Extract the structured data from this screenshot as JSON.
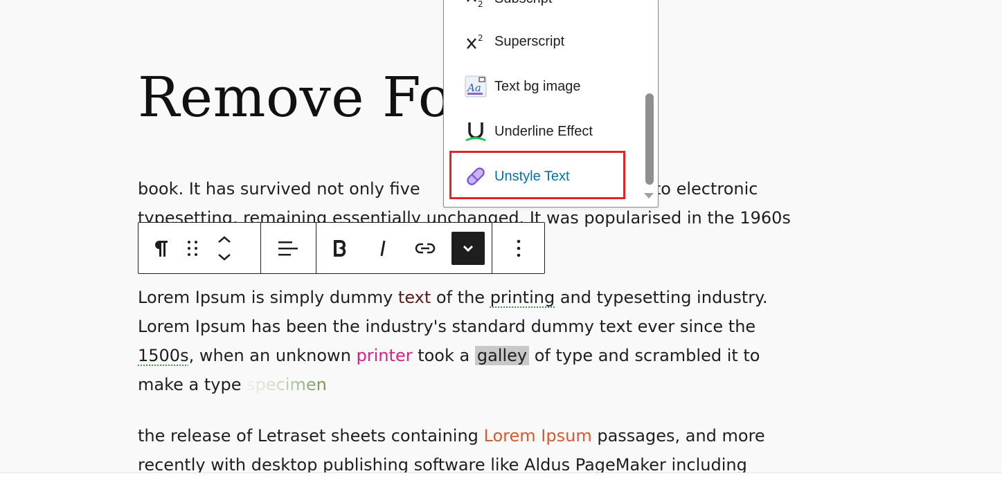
{
  "post_title": "Remove Forr",
  "paragraph_1": {
    "line1_a": "book. It has survived not only five",
    "line1_b": "eap into electronic",
    "line2": "typesetting, remaining essentially unchanged. It was popularised in the 1960s"
  },
  "paragraph_2": {
    "line1": {
      "a": "Lorem Ipsum is simply dummy ",
      "red": "text",
      "b": " of the ",
      "dotted": "printing",
      "c": " and typesetting industry."
    },
    "line2": "Lorem Ipsum has been the industry's standard dummy text ever since the",
    "line3": {
      "dotted": "1500s",
      "a": ", when an unknown ",
      "pink": "printer",
      "b": " took a ",
      "highlight": "galley",
      "c": " of type and scrambled it to"
    },
    "line4": {
      "a": "make a type ",
      "gradient": "specimen"
    }
  },
  "paragraph_3": {
    "line1": {
      "a": "the release of Letraset sheets containing ",
      "orange": "Lorem Ipsum",
      "b": " passages, and more"
    },
    "line2": "recently with desktop publishing software like Aldus PageMaker including"
  },
  "toolbar": {
    "paragraph": "paragraph-icon",
    "drag": "drag-handle-icon",
    "move": "move-up-down-icon",
    "align": "align-left-icon",
    "bold": "bold-icon",
    "italic": "italic-icon",
    "link": "link-icon",
    "more_rich_text": "chevron-down-icon",
    "options": "more-vertical-icon"
  },
  "format_menu": {
    "items": [
      {
        "label": "Subscript",
        "icon": "subscript-icon"
      },
      {
        "label": "Superscript",
        "icon": "superscript-icon"
      },
      {
        "label": "Text bg image",
        "icon": "text-bg-image-icon"
      },
      {
        "label": "Underline Effect",
        "icon": "underline-effect-icon"
      },
      {
        "label": "Unstyle Text",
        "icon": "eraser-icon",
        "selected": true
      }
    ]
  },
  "colors": {
    "selected_text": "#0073aa",
    "highlight_box": "#e0242a",
    "pink_text": "#d6218a",
    "orange_text": "#d45a30"
  }
}
